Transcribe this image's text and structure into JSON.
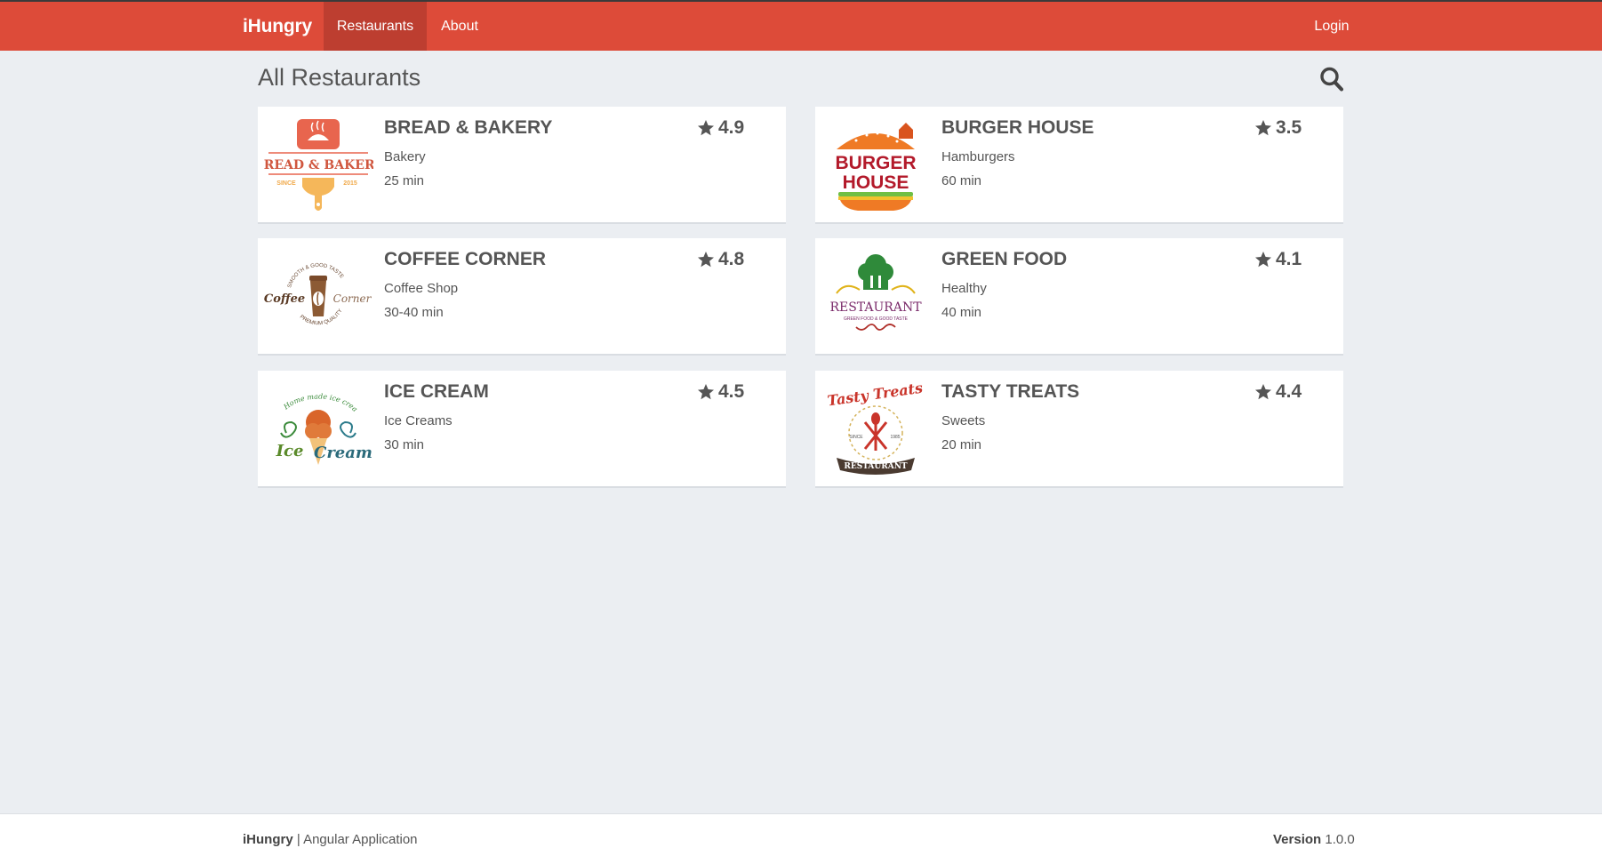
{
  "navbar": {
    "brand": "iHungry",
    "items": [
      {
        "label": "Restaurants",
        "active": true
      },
      {
        "label": "About",
        "active": false
      }
    ],
    "login": "Login",
    "color": "#dd4b39",
    "active_color": "#bd3e30"
  },
  "page": {
    "title": "All Restaurants",
    "search_icon": "search-icon"
  },
  "restaurants": [
    {
      "name": "BREAD & BAKERY",
      "category": "Bakery",
      "time": "25 min",
      "rating": "4.9",
      "logo": {
        "line1": "BREAD & BAKERY",
        "line2": "SINCE",
        "line3": "2015"
      }
    },
    {
      "name": "BURGER HOUSE",
      "category": "Hamburgers",
      "time": "60 min",
      "rating": "3.5",
      "logo": {
        "line1": "BURGER",
        "line2": "HOUSE"
      }
    },
    {
      "name": "COFFEE CORNER",
      "category": "Coffee Shop",
      "time": "30-40 min",
      "rating": "4.8",
      "logo": {
        "line1": "Coffee",
        "line2": "Corner",
        "line3": "SMOOTH & GOOD TASTE",
        "line4": "PREMIUM QUALITY"
      }
    },
    {
      "name": "GREEN FOOD",
      "category": "Healthy",
      "time": "40 min",
      "rating": "4.1",
      "logo": {
        "line1": "RESTAURANT",
        "line2": "GREEN FOOD & GOOD TASTE"
      }
    },
    {
      "name": "ICE CREAM",
      "category": "Ice Creams",
      "time": "30 min",
      "rating": "4.5",
      "logo": {
        "line1": "Home made ice cream",
        "line2": "Ice",
        "line3": "Cream"
      }
    },
    {
      "name": "TASTY TREATS",
      "category": "Sweets",
      "time": "20 min",
      "rating": "4.4",
      "logo": {
        "line1": "Tasty Treats",
        "line2": "SINCE",
        "line3": "1985",
        "line4": "RESTAURANT"
      }
    }
  ],
  "footer": {
    "brand": "iHungry",
    "tagline": "| Angular Application",
    "version_label": "Version",
    "version": "1.0.0"
  }
}
